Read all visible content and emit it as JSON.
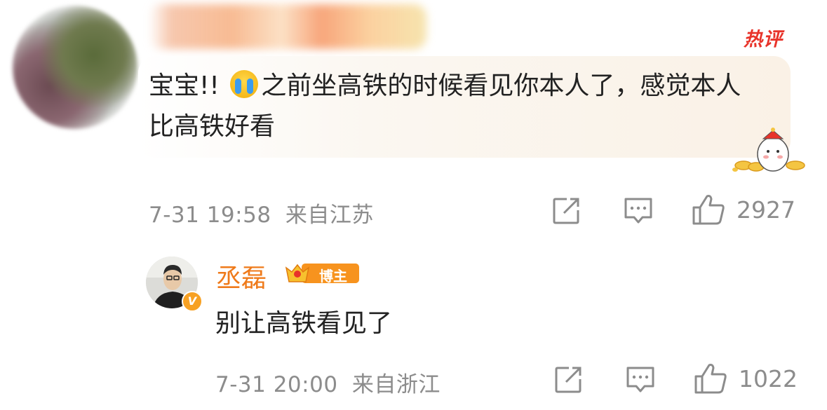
{
  "comment": {
    "badge": "热评",
    "text_part1": "宝宝!! ",
    "text_part2": "之前坐高铁的时候看见你本人了，感觉本人比高铁好看",
    "emoji": "crying-face",
    "time": "7-31 19:58",
    "location": "来自江苏",
    "like_count": "2927"
  },
  "reply": {
    "author_name": "丞磊",
    "author_badge": "博主",
    "verified_mark": "V",
    "text": "别让高铁看见了",
    "time": "7-31 20:00",
    "location": "来自浙江",
    "like_count": "1022"
  },
  "colors": {
    "hot": "#e8332a",
    "accent": "#ef7a1a",
    "meta": "#8c8c8c"
  }
}
